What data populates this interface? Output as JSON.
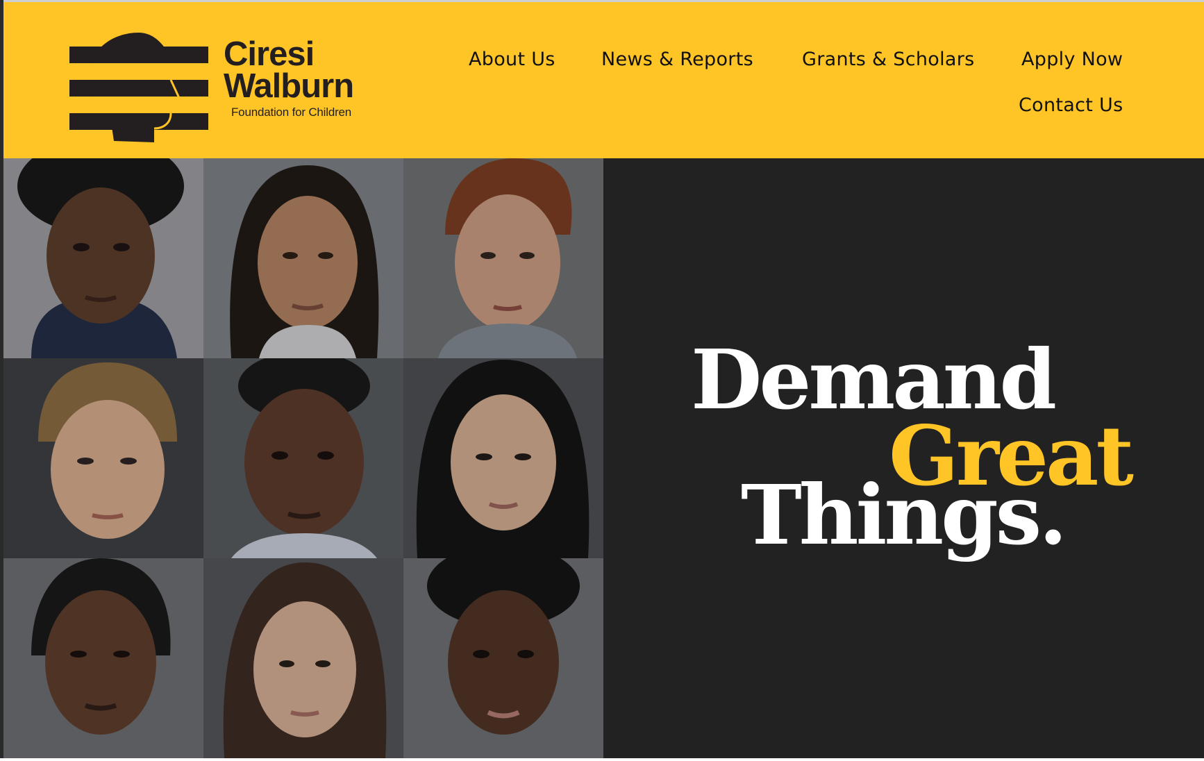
{
  "brand": {
    "name_line1": "Ciresi",
    "name_line2": "Walburn",
    "tagline": "Foundation for Children",
    "colors": {
      "yellow": "#ffc425",
      "dark": "#231f20",
      "hero_bg": "#222222"
    }
  },
  "nav": {
    "items": [
      {
        "label": "About Us"
      },
      {
        "label": "News & Reports"
      },
      {
        "label": "Grants & Scholars"
      },
      {
        "label": "Apply Now"
      },
      {
        "label": "Contact Us"
      }
    ]
  },
  "hero": {
    "headline_word1": "Demand",
    "headline_word2": "Great",
    "headline_word3": "Things."
  }
}
